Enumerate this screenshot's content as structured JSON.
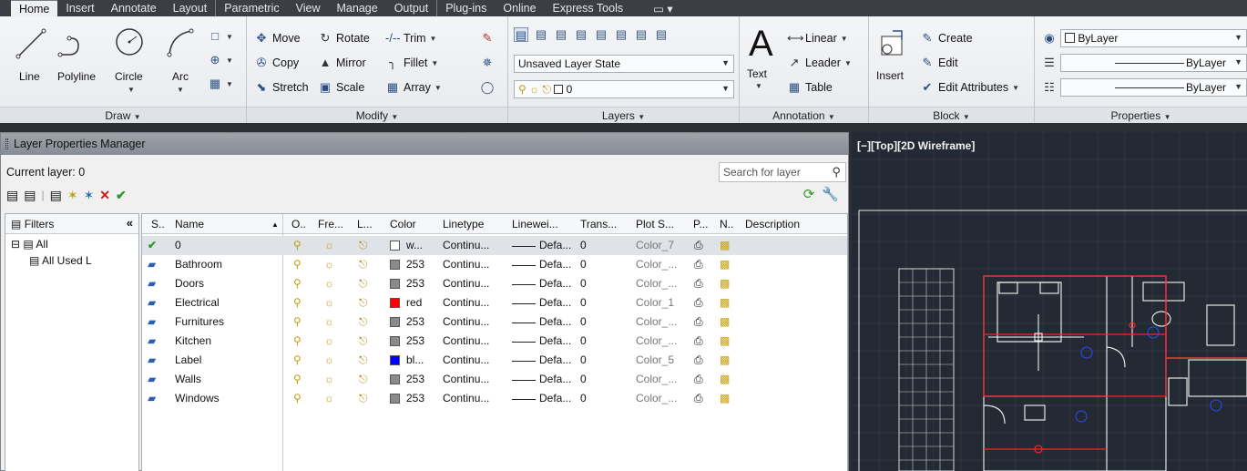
{
  "tabs": [
    "Home",
    "Insert",
    "Annotate",
    "Layout",
    "Parametric",
    "View",
    "Manage",
    "Output",
    "Plug-ins",
    "Online",
    "Express Tools"
  ],
  "draw": {
    "tools": [
      "Line",
      "Polyline",
      "Circle",
      "Arc"
    ],
    "title": "Draw"
  },
  "modify": {
    "move": "Move",
    "rotate": "Rotate",
    "trim": "Trim",
    "copy": "Copy",
    "mirror": "Mirror",
    "fillet": "Fillet",
    "stretch": "Stretch",
    "scale": "Scale",
    "array": "Array",
    "title": "Modify"
  },
  "layers": {
    "state": "Unsaved Layer State",
    "current": "0",
    "title": "Layers"
  },
  "annotation": {
    "text": "Text",
    "linear": "Linear",
    "leader": "Leader",
    "table": "Table",
    "title": "Annotation"
  },
  "block": {
    "insert": "Insert",
    "create": "Create",
    "edit": "Edit",
    "edit_attributes": "Edit Attributes",
    "title": "Block"
  },
  "properties": {
    "color": "ByLayer",
    "linetype": "ByLayer",
    "lineweight": "ByLayer",
    "title": "Properties"
  },
  "lpm": {
    "title": "Layer Properties Manager",
    "current_layer": "Current layer: 0",
    "search_placeholder": "Search for layer",
    "filters_label": "Filters",
    "tree_all": "All",
    "tree_used": "All Used L",
    "columns": [
      "S..",
      "Name",
      "O..",
      "Fre...",
      "L...",
      "Color",
      "Linetype",
      "Linewei...",
      "Trans...",
      "Plot S...",
      "P...",
      "N..",
      "Description"
    ],
    "rows": [
      {
        "name": "0",
        "color": "w...",
        "swatch": "#ffffff",
        "linetype": "Continu...",
        "lineweight": "Defa...",
        "trans": "0",
        "plot": "Color_7",
        "current": true
      },
      {
        "name": "Bathroom",
        "color": "253",
        "swatch": "#8a8a8a",
        "linetype": "Continu...",
        "lineweight": "Defa...",
        "trans": "0",
        "plot": "Color_..."
      },
      {
        "name": "Doors",
        "color": "253",
        "swatch": "#8a8a8a",
        "linetype": "Continu...",
        "lineweight": "Defa...",
        "trans": "0",
        "plot": "Color_..."
      },
      {
        "name": "Electrical",
        "color": "red",
        "swatch": "#ff0000",
        "linetype": "Continu...",
        "lineweight": "Defa...",
        "trans": "0",
        "plot": "Color_1"
      },
      {
        "name": "Furnitures",
        "color": "253",
        "swatch": "#8a8a8a",
        "linetype": "Continu...",
        "lineweight": "Defa...",
        "trans": "0",
        "plot": "Color_..."
      },
      {
        "name": "Kitchen",
        "color": "253",
        "swatch": "#8a8a8a",
        "linetype": "Continu...",
        "lineweight": "Defa...",
        "trans": "0",
        "plot": "Color_..."
      },
      {
        "name": "Label",
        "color": "bl...",
        "swatch": "#0000ff",
        "linetype": "Continu...",
        "lineweight": "Defa...",
        "trans": "0",
        "plot": "Color_5"
      },
      {
        "name": "Walls",
        "color": "253",
        "swatch": "#8a8a8a",
        "linetype": "Continu...",
        "lineweight": "Defa...",
        "trans": "0",
        "plot": "Color_..."
      },
      {
        "name": "Windows",
        "color": "253",
        "swatch": "#8a8a8a",
        "linetype": "Continu...",
        "lineweight": "Defa...",
        "trans": "0",
        "plot": "Color_..."
      }
    ]
  },
  "viewport": {
    "label": "[−][Top][2D Wireframe]"
  }
}
